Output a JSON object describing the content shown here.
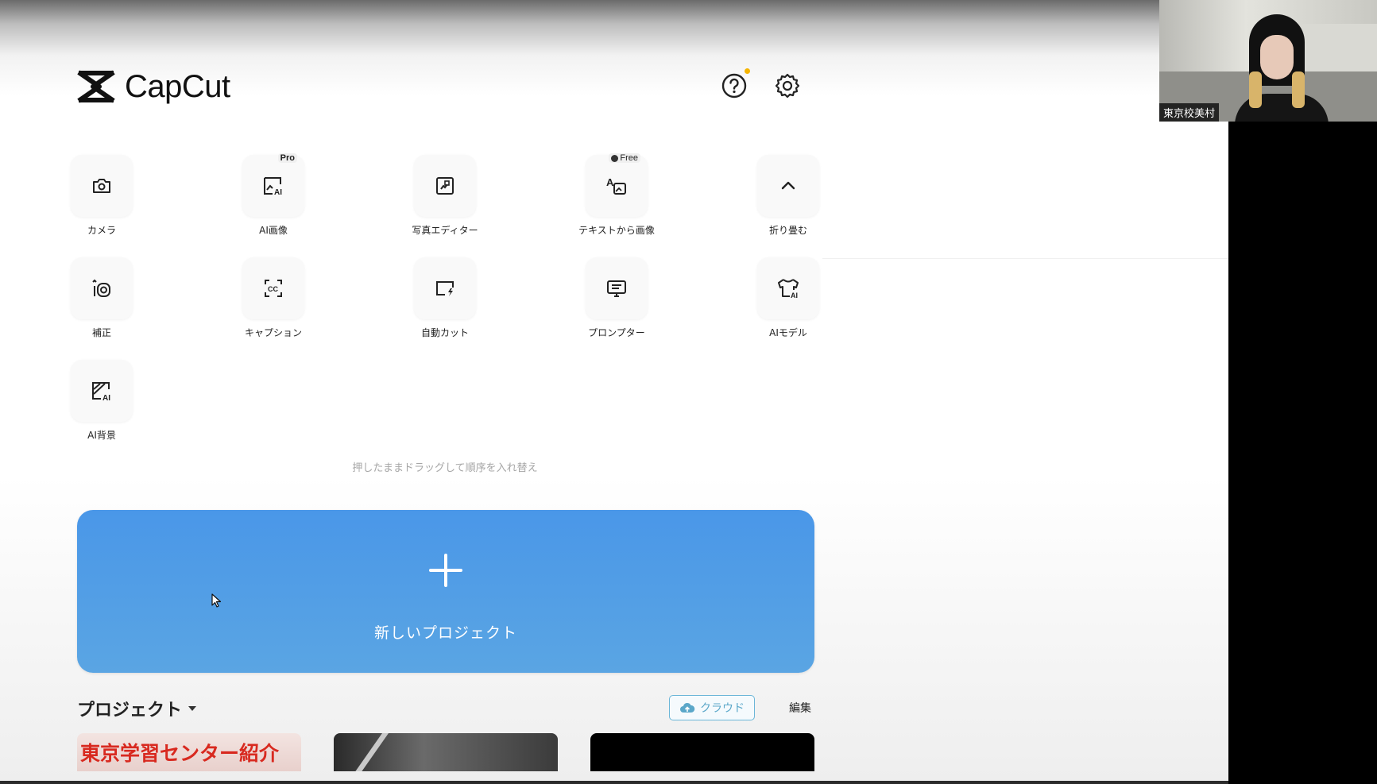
{
  "app": {
    "name": "CapCut"
  },
  "header": {
    "help_icon": "help-icon",
    "settings_icon": "gear-icon"
  },
  "tools": [
    {
      "label": "カメラ",
      "icon": "camera-icon"
    },
    {
      "label": "AI画像",
      "icon": "ai-image-icon",
      "badge": "Pro"
    },
    {
      "label": "写真エディター",
      "icon": "photo-editor-icon"
    },
    {
      "label": "テキストから画像",
      "icon": "text-to-image-icon",
      "badge": "Free"
    },
    {
      "label": "折り畳む",
      "icon": "chevron-up-icon"
    },
    {
      "label": "補正",
      "icon": "retouch-icon"
    },
    {
      "label": "キャプション",
      "icon": "captions-icon"
    },
    {
      "label": "自動カット",
      "icon": "autocut-icon"
    },
    {
      "label": "プロンプター",
      "icon": "prompter-icon"
    },
    {
      "label": "AIモデル",
      "icon": "ai-model-icon"
    },
    {
      "label": "AI背景",
      "icon": "ai-background-icon"
    }
  ],
  "hint": "押したままドラッグして順序を入れ替え",
  "new_project": {
    "label": "新しいプロジェクト"
  },
  "projects": {
    "title": "プロジェクト",
    "cloud_label": "クラウド",
    "edit_label": "編集",
    "items": [
      {
        "title": "東京学習センター紹介"
      },
      {
        "title": ""
      },
      {
        "title": ""
      }
    ]
  },
  "webcam": {
    "name": "東京校美村"
  },
  "colors": {
    "accent": "#4a97e8",
    "cloud": "#5aa7c9",
    "badge_dot": "#f5b400"
  }
}
